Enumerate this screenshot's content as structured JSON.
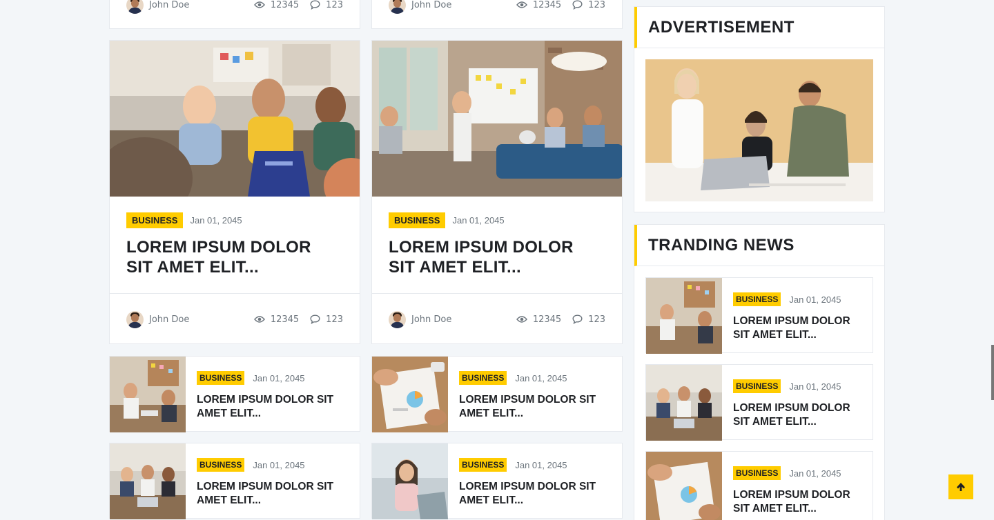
{
  "top_cards": [
    {
      "author": "John Doe",
      "views": "12345",
      "comments": "123"
    },
    {
      "author": "John Doe",
      "views": "12345",
      "comments": "123"
    }
  ],
  "featured": [
    {
      "category": "BUSINESS",
      "date": "Jan 01, 2045",
      "title_line1": "LOREM IPSUM DOLOR",
      "title_line2": "SIT AMET ELIT...",
      "author": "John Doe",
      "views": "12345",
      "comments": "123",
      "image": "team-meeting-laptops-photo"
    },
    {
      "category": "BUSINESS",
      "date": "Jan 01, 2045",
      "title_line1": "LOREM IPSUM DOLOR",
      "title_line2": "SIT AMET ELIT...",
      "author": "John Doe",
      "views": "12345",
      "comments": "123",
      "image": "office-whiteboard-presentation-photo"
    }
  ],
  "small_posts": [
    {
      "category": "BUSINESS",
      "date": "Jan 01, 2045",
      "title_line1": "LOREM IPSUM DOLOR SIT",
      "title_line2": "AMET ELIT...",
      "image": "handshake-meeting-thumb"
    },
    {
      "category": "BUSINESS",
      "date": "Jan 01, 2045",
      "title_line1": "LOREM IPSUM DOLOR SIT",
      "title_line2": "AMET ELIT...",
      "image": "charts-paperwork-thumb"
    },
    {
      "category": "BUSINESS",
      "date": "Jan 01, 2045",
      "title_line1": "LOREM IPSUM DOLOR SIT",
      "title_line2": "AMET ELIT...",
      "image": "conference-room-thumb"
    },
    {
      "category": "BUSINESS",
      "date": "Jan 01, 2045",
      "title_line1": "LOREM IPSUM DOLOR SIT",
      "title_line2": "AMET ELIT...",
      "image": "woman-smiling-laptop-thumb"
    }
  ],
  "sidebar": {
    "advertisement_title": "ADVERTISEMENT",
    "advertisement_image": "colleagues-at-laptop-ad",
    "trending_title": "TRANDING NEWS",
    "trending": [
      {
        "category": "BUSINESS",
        "date": "Jan 01, 2045",
        "title_line1": "LOREM IPSUM DOLOR",
        "title_line2": "SIT AMET ELIT...",
        "image": "handshake-meeting-thumb"
      },
      {
        "category": "BUSINESS",
        "date": "Jan 01, 2045",
        "title_line1": "LOREM IPSUM DOLOR",
        "title_line2": "SIT AMET ELIT...",
        "image": "conference-room-thumb"
      },
      {
        "category": "BUSINESS",
        "date": "Jan 01, 2045",
        "title_line1": "LOREM IPSUM DOLOR",
        "title_line2": "SIT AMET ELIT...",
        "image": "charts-paperwork-thumb"
      }
    ]
  },
  "colors": {
    "accent": "#ffcc00",
    "text": "#1e2024",
    "muted": "#6c757d",
    "background": "#f3f6f9"
  },
  "icons": {
    "views": "eye-icon",
    "comments": "comment-icon",
    "scroll_top": "arrow-up-icon"
  }
}
